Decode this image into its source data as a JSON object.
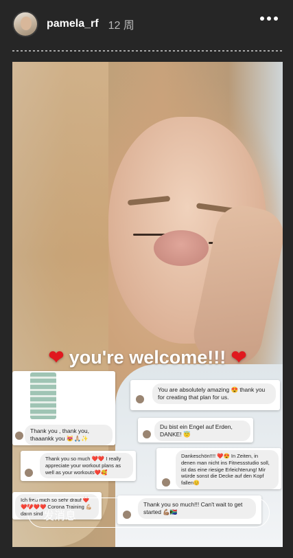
{
  "header": {
    "username": "pamela_rf",
    "time": "12 周",
    "more_icon": "more-options-icon"
  },
  "story": {
    "caption": "you're welcome!!!",
    "messages": [
      {
        "text": "Thank you , thank you, thaaankk you 😻🙏🏼✨"
      },
      {
        "text": "You are absolutely amazing 😍 thank you for creating that plan for us."
      },
      {
        "text": "Du bist ein Engel auf Erden, DANKE! 😇"
      },
      {
        "text": "Thank you so much ❤️❤️ I really appreciate your workout plans as well as your workouts❤️🥰"
      },
      {
        "text": "Dankeschön!!!! ❤️😍 In Zeiten, in denen man nicht ins Fitnessstudio soll, ist das eine riesige Erleichterung! Mir würde sonst die Decke auf den Kopf fallen😊"
      },
      {
        "text": "Ich freu mich so sehr drauf ❤️❤️❤️❤️❤️ Corona Training 💪🏼 dann sind"
      },
      {
        "text": "Thank you so much!!! Can't wait to get started 💪🏽🇿🇦"
      }
    ]
  },
  "reply": {
    "placeholder": "发消息"
  }
}
